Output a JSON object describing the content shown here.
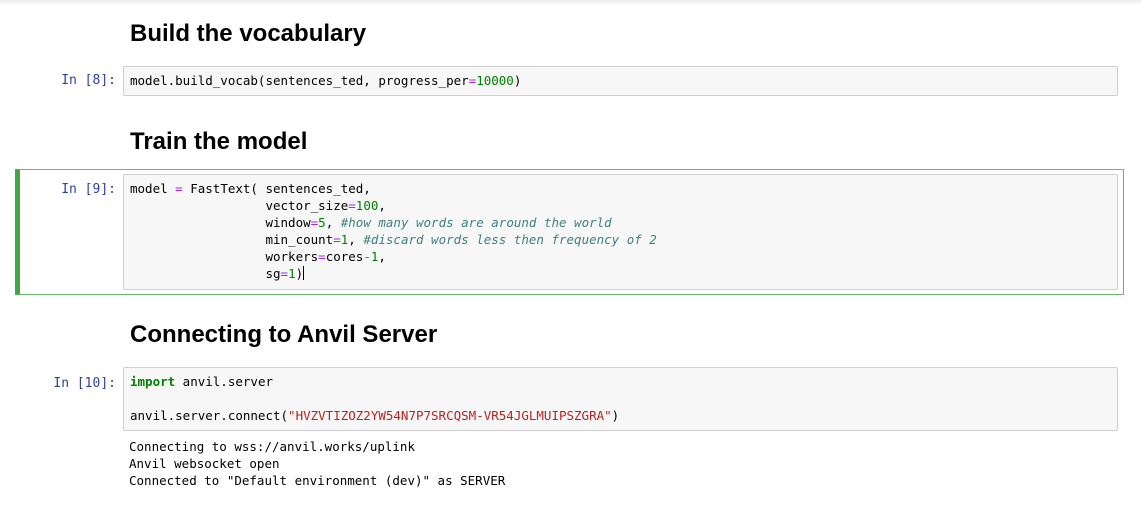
{
  "headings": {
    "vocab": "Build the vocabulary",
    "train": "Train the model",
    "anvil": "Connecting to Anvil Server"
  },
  "cells": {
    "vocab": {
      "prompt": "In [8]:",
      "code": {
        "a": "model.build_vocab(sentences_ted, progress_per",
        "eq": "=",
        "num": "10000",
        "b": ")"
      }
    },
    "train": {
      "prompt": "In [9]:",
      "code": {
        "l1": "model ",
        "l1_eq": "=",
        "l1_b": " FastText( sentences_ted,",
        "indent": "                  ",
        "l2_a": "vector_size",
        "l2_num": "100",
        "l3_a": "window",
        "l3_num": "5",
        "l3_cm": "#how many words are around the world",
        "l4_a": "min_count",
        "l4_num": "1",
        "l4_cm": "#discard words less then frequency of 2",
        "l5_a": "workers",
        "l5_b": "cores",
        "l5_num": "1",
        "l6_a": "sg",
        "l6_num": "1",
        "l6_close": ")"
      }
    },
    "anvil": {
      "prompt": "In [10]:",
      "code": {
        "import_kw": "import",
        "import_mod": " anvil.server",
        "connect_a": "anvil.server.connect(",
        "connect_str": "\"HVZVTIZOZ2YW54N7P7SRCQSM-VR54JGLMUIPSZGRA\"",
        "connect_b": ")"
      },
      "output": [
        "Connecting to wss://anvil.works/uplink",
        "Anvil websocket open",
        "Connected to \"Default environment (dev)\" as SERVER"
      ]
    }
  },
  "colors": {
    "prompt": "#303f9f",
    "selected_border": "#42a548",
    "keyword": "#008000",
    "operator": "#aa22ff",
    "string": "#ba2121",
    "comment": "#408080"
  }
}
